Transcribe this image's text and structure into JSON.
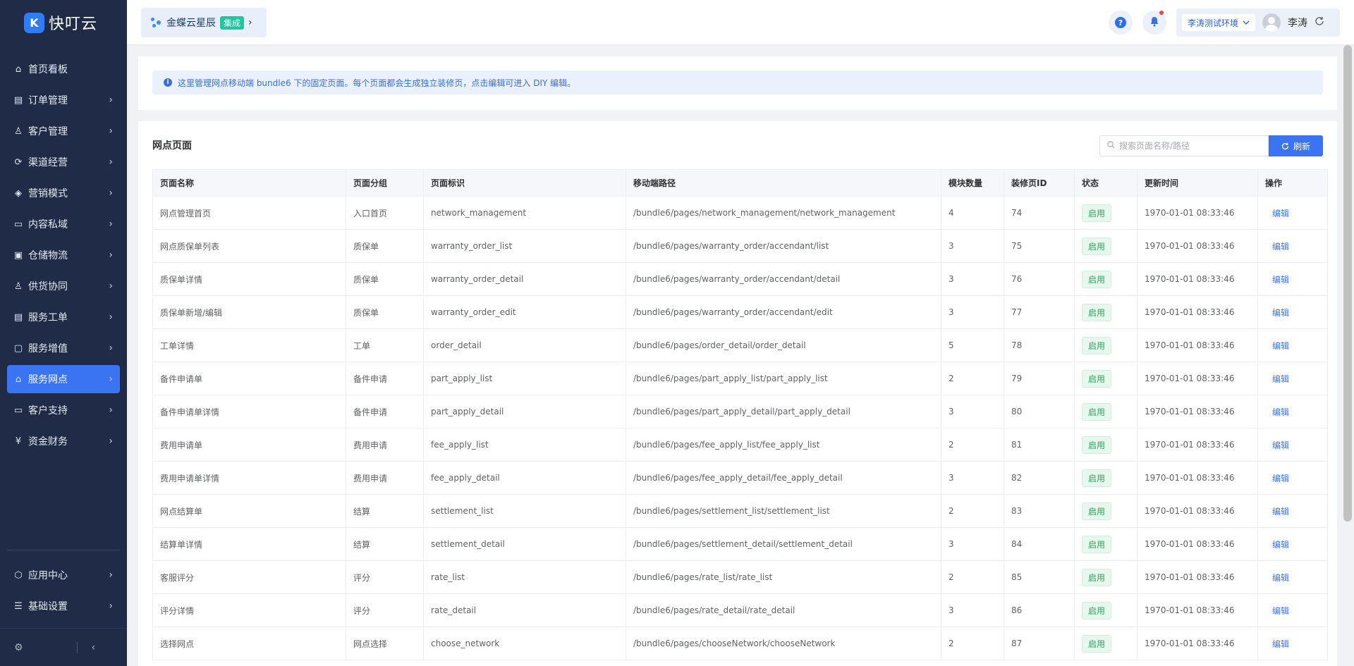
{
  "brand": {
    "logo_char": "K",
    "name": "快叮云"
  },
  "app_switch": {
    "name": "金蝶云星辰",
    "badge": "集成",
    "arrow": "›"
  },
  "header": {
    "env_label": "李涛测试环境",
    "user_name": "李涛",
    "help_char": "?"
  },
  "sidebar": {
    "items": [
      {
        "label": "首页看板",
        "icon": "home-icon",
        "glyph": "⌂",
        "arrow": ""
      },
      {
        "label": "订单管理",
        "icon": "order-icon",
        "glyph": "▤",
        "arrow": "›"
      },
      {
        "label": "客户管理",
        "icon": "user-icon",
        "glyph": "♙",
        "arrow": "›"
      },
      {
        "label": "渠道经营",
        "icon": "channel-icon",
        "glyph": "⟳",
        "arrow": "›"
      },
      {
        "label": "营销模式",
        "icon": "tag-icon",
        "glyph": "◈",
        "arrow": "›"
      },
      {
        "label": "内容私域",
        "icon": "image-icon",
        "glyph": "▭",
        "arrow": "›"
      },
      {
        "label": "仓储物流",
        "icon": "warehouse-icon",
        "glyph": "▣",
        "arrow": "›"
      },
      {
        "label": "供货协同",
        "icon": "supply-icon",
        "glyph": "♙",
        "arrow": "›"
      },
      {
        "label": "服务工单",
        "icon": "ticket-icon",
        "glyph": "▤",
        "arrow": "›"
      },
      {
        "label": "服务增值",
        "icon": "bag-icon",
        "glyph": "▢",
        "arrow": "›"
      },
      {
        "label": "服务网点",
        "icon": "store-icon",
        "glyph": "⌂",
        "arrow": "›",
        "active": true
      },
      {
        "label": "客户支持",
        "icon": "support-icon",
        "glyph": "▭",
        "arrow": "›"
      },
      {
        "label": "资金财务",
        "icon": "finance-icon",
        "glyph": "¥",
        "arrow": "›"
      }
    ],
    "bottom_items": [
      {
        "label": "应用中心",
        "icon": "app-center-icon",
        "glyph": "⬡",
        "arrow": "›"
      },
      {
        "label": "基础设置",
        "icon": "settings-list-icon",
        "glyph": "☰",
        "arrow": "›"
      }
    ],
    "footer_gear": "⚙",
    "footer_collapse": "‹"
  },
  "notice": {
    "text": "这里管理网点移动端 bundle6 下的固定页面。每个页面都会生成独立装修页，点击编辑可进入 DIY 编辑。"
  },
  "table_card": {
    "title": "网点页面",
    "search_placeholder": "搜索页面名称/路径",
    "refresh_label": "刷新",
    "columns": [
      "页面名称",
      "页面分组",
      "页面标识",
      "移动端路径",
      "模块数量",
      "装修页ID",
      "状态",
      "更新时间",
      "操作"
    ],
    "rows": [
      [
        "网点管理首页",
        "入口首页",
        "network_management",
        "/bundle6/pages/network_management/network_management",
        "4",
        "74",
        "启用",
        "1970-01-01 08:33:46",
        "编辑"
      ],
      [
        "网点质保单列表",
        "质保单",
        "warranty_order_list",
        "/bundle6/pages/warranty_order/accendant/list",
        "3",
        "75",
        "启用",
        "1970-01-01 08:33:46",
        "编辑"
      ],
      [
        "质保单详情",
        "质保单",
        "warranty_order_detail",
        "/bundle6/pages/warranty_order/accendant/detail",
        "3",
        "76",
        "启用",
        "1970-01-01 08:33:46",
        "编辑"
      ],
      [
        "质保单新增/编辑",
        "质保单",
        "warranty_order_edit",
        "/bundle6/pages/warranty_order/accendant/edit",
        "3",
        "77",
        "启用",
        "1970-01-01 08:33:46",
        "编辑"
      ],
      [
        "工单详情",
        "工单",
        "order_detail",
        "/bundle6/pages/order_detail/order_detail",
        "5",
        "78",
        "启用",
        "1970-01-01 08:33:46",
        "编辑"
      ],
      [
        "备件申请单",
        "备件申请",
        "part_apply_list",
        "/bundle6/pages/part_apply_list/part_apply_list",
        "2",
        "79",
        "启用",
        "1970-01-01 08:33:46",
        "编辑"
      ],
      [
        "备件申请单详情",
        "备件申请",
        "part_apply_detail",
        "/bundle6/pages/part_apply_detail/part_apply_detail",
        "3",
        "80",
        "启用",
        "1970-01-01 08:33:46",
        "编辑"
      ],
      [
        "费用申请单",
        "费用申请",
        "fee_apply_list",
        "/bundle6/pages/fee_apply_list/fee_apply_list",
        "2",
        "81",
        "启用",
        "1970-01-01 08:33:46",
        "编辑"
      ],
      [
        "费用申请单详情",
        "费用申请",
        "fee_apply_detail",
        "/bundle6/pages/fee_apply_detail/fee_apply_detail",
        "3",
        "82",
        "启用",
        "1970-01-01 08:33:46",
        "编辑"
      ],
      [
        "网点结算单",
        "结算",
        "settlement_list",
        "/bundle6/pages/settlement_list/settlement_list",
        "2",
        "83",
        "启用",
        "1970-01-01 08:33:46",
        "编辑"
      ],
      [
        "结算单详情",
        "结算",
        "settlement_detail",
        "/bundle6/pages/settlement_detail/settlement_detail",
        "3",
        "84",
        "启用",
        "1970-01-01 08:33:46",
        "编辑"
      ],
      [
        "客服评分",
        "评分",
        "rate_list",
        "/bundle6/pages/rate_list/rate_list",
        "2",
        "85",
        "启用",
        "1970-01-01 08:33:46",
        "编辑"
      ],
      [
        "评分详情",
        "评分",
        "rate_detail",
        "/bundle6/pages/rate_detail/rate_detail",
        "3",
        "86",
        "启用",
        "1970-01-01 08:33:46",
        "编辑"
      ],
      [
        "选择网点",
        "网点选择",
        "choose_network",
        "/bundle6/pages/chooseNetwork/chooseNetwork",
        "2",
        "87",
        "启用",
        "1970-01-01 08:33:46",
        "编辑"
      ]
    ]
  },
  "colors": {
    "sidebar_bg": "#1f2b47",
    "accent": "#3b74f2",
    "status_green": "#2aa55c"
  }
}
